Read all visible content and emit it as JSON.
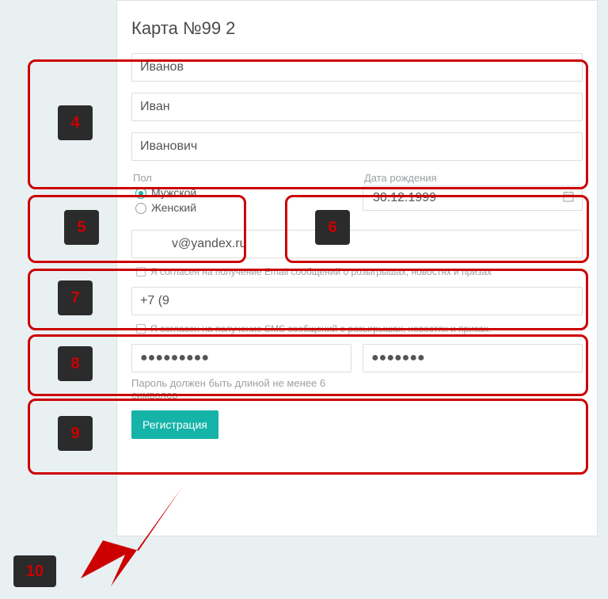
{
  "title": "Карта №99              2",
  "name": {
    "surname": "Иванов",
    "firstname": "Иван",
    "patronymic": "Иванович"
  },
  "gender": {
    "label": "Пол",
    "male": "Мужской",
    "female": "Женский",
    "selected": "male"
  },
  "dob": {
    "label": "Дата рождения",
    "value": "30.12.1999"
  },
  "email": {
    "value": "         v@yandex.ru",
    "consent": "Я согласен на получение Email сообщений о розыгрышах, новостях и призах"
  },
  "phone": {
    "value": "+7 (9",
    "consent": "Я согласен на получение SMS сообщений о розыгрышах, новостях и призах."
  },
  "password": {
    "value": "●●●●●●●●●",
    "confirm": "●●●●●●●",
    "hint": "Пароль должен быть длиной не менее 6 символов"
  },
  "submit": "Регистрация",
  "annotations": {
    "b4": "4",
    "b5": "5",
    "b6": "6",
    "b7": "7",
    "b8": "8",
    "b9": "9",
    "b10": "10"
  }
}
